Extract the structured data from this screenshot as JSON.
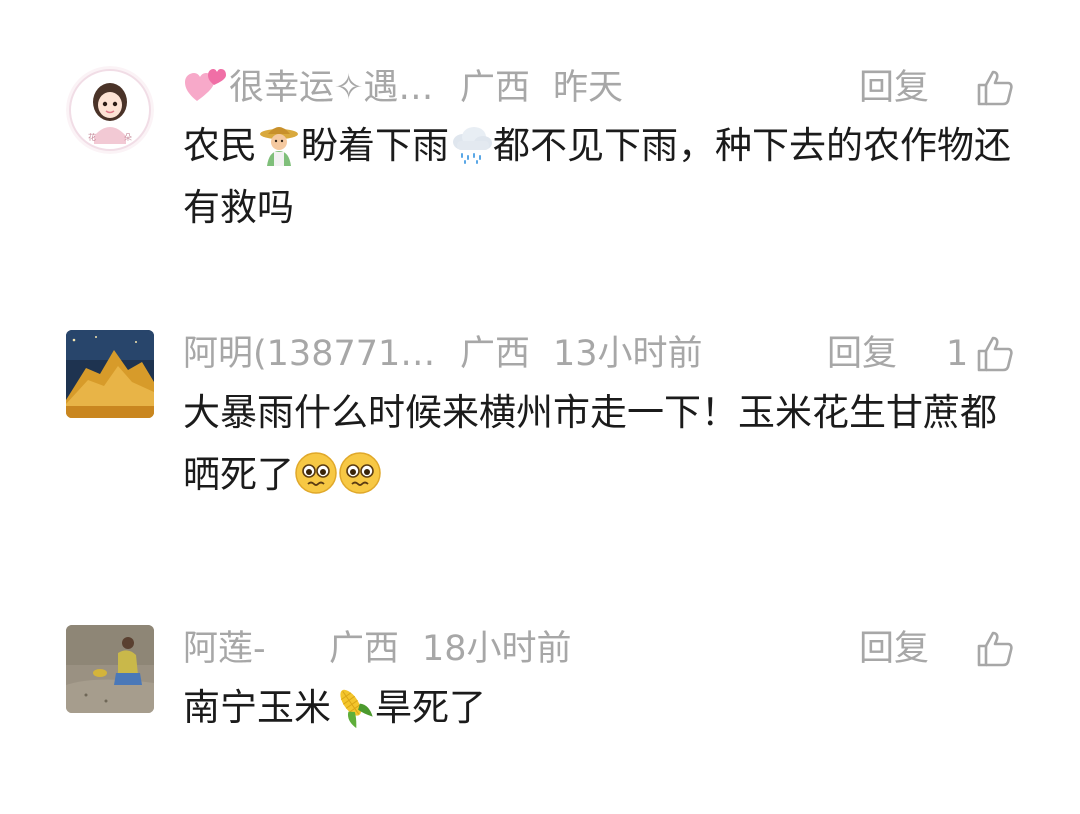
{
  "comments": [
    {
      "avatar_icon": "cartoon-girl-avatar",
      "name_prefix_icon": "pink-hearts-icon",
      "name": "很幸运✧遇…",
      "region": "广西",
      "time": "昨天",
      "reply_label": "回复",
      "like_count": "",
      "text_parts": [
        "农民",
        "盼着下雨",
        "都不见下雨，种下去的农作物还有救吗"
      ],
      "emojis": [
        "farmer-emoji",
        "rain-cloud-emoji"
      ]
    },
    {
      "avatar_icon": "golden-mountain-avatar",
      "name": "阿明(138771…",
      "region": "广西",
      "time": "13小时前",
      "reply_label": "回复",
      "like_count": "1",
      "text_parts": [
        "大暴雨什么时候来横州市走一下！玉米花生甘蔗都晒死了"
      ],
      "emojis": [
        "pleading-face-emoji",
        "pleading-face-emoji"
      ]
    },
    {
      "avatar_icon": "child-in-field-avatar",
      "name": "阿莲-",
      "region": "广西",
      "time": "18小时前",
      "reply_label": "回复",
      "like_count": "",
      "text_parts": [
        "南宁玉米",
        "旱死了"
      ],
      "emojis": [
        "corn-emoji"
      ]
    }
  ],
  "colors": {
    "meta_gray": "#a7a7a7",
    "body_text": "#1b1b1b",
    "background": "#ffffff"
  }
}
